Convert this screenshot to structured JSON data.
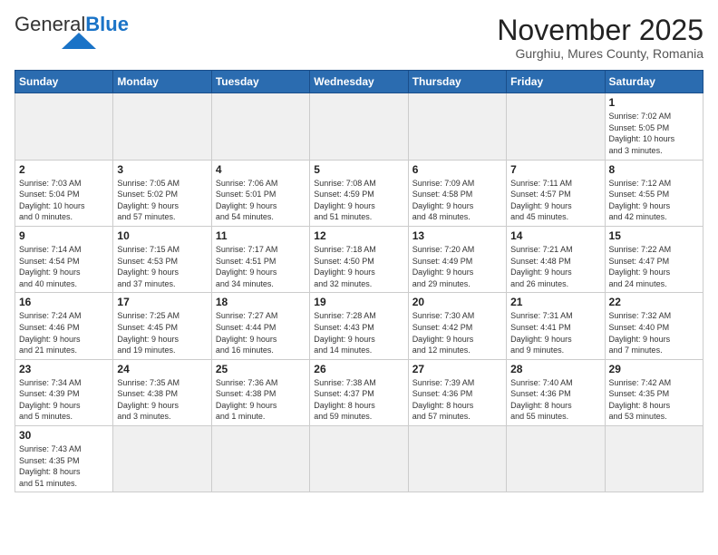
{
  "logo": {
    "general": "General",
    "blue": "Blue"
  },
  "header": {
    "month": "November 2025",
    "location": "Gurghiu, Mures County, Romania"
  },
  "weekdays": [
    "Sunday",
    "Monday",
    "Tuesday",
    "Wednesday",
    "Thursday",
    "Friday",
    "Saturday"
  ],
  "weeks": [
    [
      {
        "day": "",
        "info": ""
      },
      {
        "day": "",
        "info": ""
      },
      {
        "day": "",
        "info": ""
      },
      {
        "day": "",
        "info": ""
      },
      {
        "day": "",
        "info": ""
      },
      {
        "day": "",
        "info": ""
      },
      {
        "day": "1",
        "info": "Sunrise: 7:02 AM\nSunset: 5:05 PM\nDaylight: 10 hours\nand 3 minutes."
      }
    ],
    [
      {
        "day": "2",
        "info": "Sunrise: 7:03 AM\nSunset: 5:04 PM\nDaylight: 10 hours\nand 0 minutes."
      },
      {
        "day": "3",
        "info": "Sunrise: 7:05 AM\nSunset: 5:02 PM\nDaylight: 9 hours\nand 57 minutes."
      },
      {
        "day": "4",
        "info": "Sunrise: 7:06 AM\nSunset: 5:01 PM\nDaylight: 9 hours\nand 54 minutes."
      },
      {
        "day": "5",
        "info": "Sunrise: 7:08 AM\nSunset: 4:59 PM\nDaylight: 9 hours\nand 51 minutes."
      },
      {
        "day": "6",
        "info": "Sunrise: 7:09 AM\nSunset: 4:58 PM\nDaylight: 9 hours\nand 48 minutes."
      },
      {
        "day": "7",
        "info": "Sunrise: 7:11 AM\nSunset: 4:57 PM\nDaylight: 9 hours\nand 45 minutes."
      },
      {
        "day": "8",
        "info": "Sunrise: 7:12 AM\nSunset: 4:55 PM\nDaylight: 9 hours\nand 42 minutes."
      }
    ],
    [
      {
        "day": "9",
        "info": "Sunrise: 7:14 AM\nSunset: 4:54 PM\nDaylight: 9 hours\nand 40 minutes."
      },
      {
        "day": "10",
        "info": "Sunrise: 7:15 AM\nSunset: 4:53 PM\nDaylight: 9 hours\nand 37 minutes."
      },
      {
        "day": "11",
        "info": "Sunrise: 7:17 AM\nSunset: 4:51 PM\nDaylight: 9 hours\nand 34 minutes."
      },
      {
        "day": "12",
        "info": "Sunrise: 7:18 AM\nSunset: 4:50 PM\nDaylight: 9 hours\nand 32 minutes."
      },
      {
        "day": "13",
        "info": "Sunrise: 7:20 AM\nSunset: 4:49 PM\nDaylight: 9 hours\nand 29 minutes."
      },
      {
        "day": "14",
        "info": "Sunrise: 7:21 AM\nSunset: 4:48 PM\nDaylight: 9 hours\nand 26 minutes."
      },
      {
        "day": "15",
        "info": "Sunrise: 7:22 AM\nSunset: 4:47 PM\nDaylight: 9 hours\nand 24 minutes."
      }
    ],
    [
      {
        "day": "16",
        "info": "Sunrise: 7:24 AM\nSunset: 4:46 PM\nDaylight: 9 hours\nand 21 minutes."
      },
      {
        "day": "17",
        "info": "Sunrise: 7:25 AM\nSunset: 4:45 PM\nDaylight: 9 hours\nand 19 minutes."
      },
      {
        "day": "18",
        "info": "Sunrise: 7:27 AM\nSunset: 4:44 PM\nDaylight: 9 hours\nand 16 minutes."
      },
      {
        "day": "19",
        "info": "Sunrise: 7:28 AM\nSunset: 4:43 PM\nDaylight: 9 hours\nand 14 minutes."
      },
      {
        "day": "20",
        "info": "Sunrise: 7:30 AM\nSunset: 4:42 PM\nDaylight: 9 hours\nand 12 minutes."
      },
      {
        "day": "21",
        "info": "Sunrise: 7:31 AM\nSunset: 4:41 PM\nDaylight: 9 hours\nand 9 minutes."
      },
      {
        "day": "22",
        "info": "Sunrise: 7:32 AM\nSunset: 4:40 PM\nDaylight: 9 hours\nand 7 minutes."
      }
    ],
    [
      {
        "day": "23",
        "info": "Sunrise: 7:34 AM\nSunset: 4:39 PM\nDaylight: 9 hours\nand 5 minutes."
      },
      {
        "day": "24",
        "info": "Sunrise: 7:35 AM\nSunset: 4:38 PM\nDaylight: 9 hours\nand 3 minutes."
      },
      {
        "day": "25",
        "info": "Sunrise: 7:36 AM\nSunset: 4:38 PM\nDaylight: 9 hours\nand 1 minute."
      },
      {
        "day": "26",
        "info": "Sunrise: 7:38 AM\nSunset: 4:37 PM\nDaylight: 8 hours\nand 59 minutes."
      },
      {
        "day": "27",
        "info": "Sunrise: 7:39 AM\nSunset: 4:36 PM\nDaylight: 8 hours\nand 57 minutes."
      },
      {
        "day": "28",
        "info": "Sunrise: 7:40 AM\nSunset: 4:36 PM\nDaylight: 8 hours\nand 55 minutes."
      },
      {
        "day": "29",
        "info": "Sunrise: 7:42 AM\nSunset: 4:35 PM\nDaylight: 8 hours\nand 53 minutes."
      }
    ],
    [
      {
        "day": "30",
        "info": "Sunrise: 7:43 AM\nSunset: 4:35 PM\nDaylight: 8 hours\nand 51 minutes."
      },
      {
        "day": "",
        "info": ""
      },
      {
        "day": "",
        "info": ""
      },
      {
        "day": "",
        "info": ""
      },
      {
        "day": "",
        "info": ""
      },
      {
        "day": "",
        "info": ""
      },
      {
        "day": "",
        "info": ""
      }
    ]
  ]
}
